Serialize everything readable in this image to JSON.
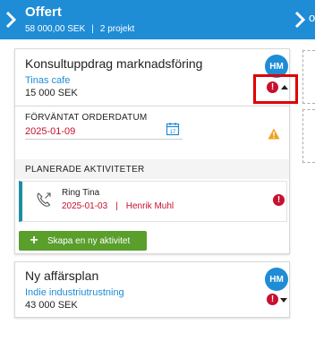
{
  "stage": {
    "title": "Offert",
    "amount": "58 000,00 SEK",
    "separator": "|",
    "count": "2 projekt",
    "next_stub": "o"
  },
  "cards": [
    {
      "title": "Konsultuppdrag marknadsföring",
      "company": "Tinas cafe",
      "amount": "15 000 SEK",
      "avatar": "HM",
      "error_glyph": "!",
      "expanded": true,
      "expected_label": "FÖRVÄNTAT ORDERDATUM",
      "expected_date": "2025-01-09",
      "calendar_day": "17",
      "activities_label": "PLANERADE AKTIVITETER",
      "activities": [
        {
          "name": "Ring Tina",
          "date": "2025-01-03",
          "separator": "|",
          "owner": "Henrik Muhl",
          "icon": "phone-outgoing-icon",
          "error_glyph": "!"
        }
      ],
      "create_activity_label": "Skapa en ny aktivitet"
    },
    {
      "title": "Ny affärsplan",
      "company": "Indie industriutrustning",
      "amount": "43 000 SEK",
      "avatar": "HM",
      "error_glyph": "!",
      "expanded": false
    }
  ],
  "colors": {
    "header_blue": "#1f8cd6",
    "error_red": "#c8102e",
    "warning_orange": "#f0a020",
    "button_green": "#5a9e2c",
    "activity_accent": "#1a8fa0",
    "highlight_red": "#e00000"
  }
}
